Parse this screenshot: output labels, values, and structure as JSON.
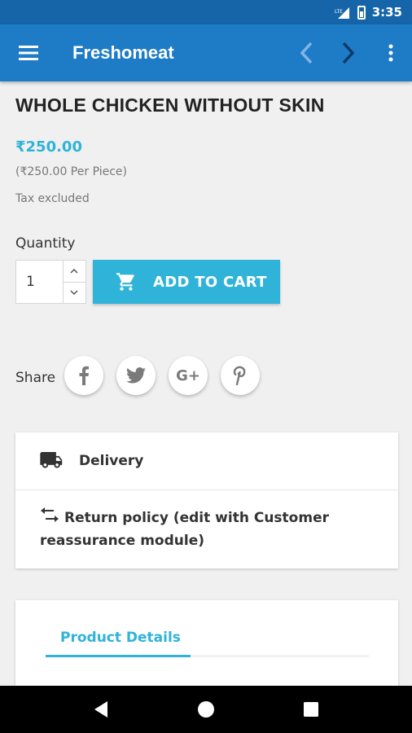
{
  "status_bar": {
    "network": "LTE",
    "time": "3:35"
  },
  "app_bar": {
    "title": "Freshomeat"
  },
  "product": {
    "title": "WHOLE CHICKEN WITHOUT SKIN",
    "price": "₹250.00",
    "unit_price": "(₹250.00 Per Piece)",
    "tax_note": "Tax excluded",
    "quantity_label": "Quantity",
    "quantity_value": "1",
    "add_to_cart_label": "ADD TO CART"
  },
  "share": {
    "label": "Share",
    "networks": [
      "facebook-icon",
      "twitter-icon",
      "google-plus-icon",
      "pinterest-icon"
    ],
    "google_plus_text": "G+"
  },
  "reassurance": {
    "delivery": "Delivery",
    "return_policy": "Return policy (edit with Customer reassurance module)"
  },
  "details": {
    "tab_label": "Product Details"
  },
  "colors": {
    "app_bar": "#1e7bc6",
    "status_bar": "#1565a8",
    "accent": "#2fb3d9",
    "background": "#f0f0f0"
  }
}
